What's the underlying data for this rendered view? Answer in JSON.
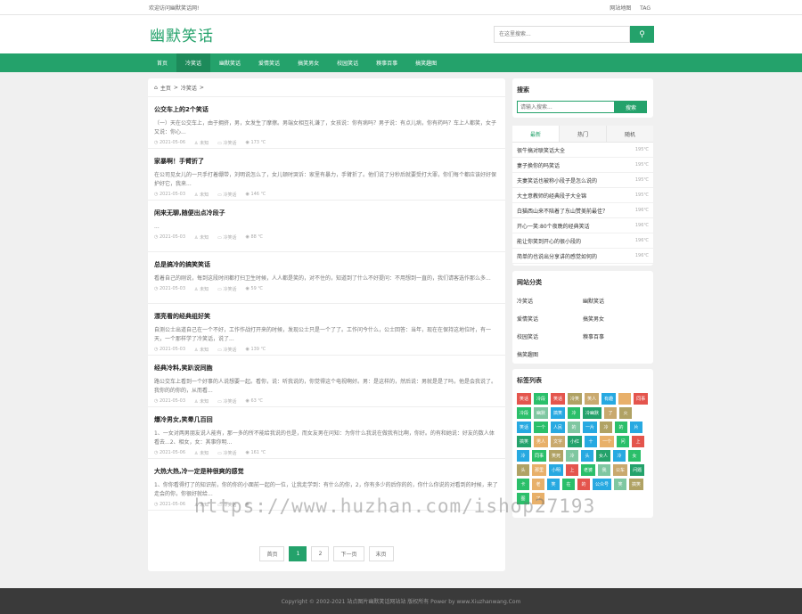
{
  "topbar": {
    "welcome": "欢迎访问幽默笑话网!",
    "links": [
      "网站地图",
      "TAG"
    ]
  },
  "header": {
    "logo": "幽默笑话",
    "search_placeholder": "在这里搜索..."
  },
  "nav": {
    "items": [
      "首页",
      "冷笑话",
      "幽默笑话",
      "爱情笑话",
      "搞笑男女",
      "校园笑话",
      "糗事百事",
      "搞笑趣图"
    ],
    "active_index": 1
  },
  "breadcrumb": {
    "home": "主页",
    "separator": ">",
    "current": "冷笑话",
    "tail": ">"
  },
  "articles": [
    {
      "title": "公交车上的2个笑话",
      "excerpt": "（一）天在公交车上，由于拥挤，男，女发生了摩擦。男端女相互礼谦了，女孩说：你有病吗？男子说：有点儿病，你有药吗？车上人都笑，女子又说：你心...",
      "date": "2021-05-06",
      "author": "未知",
      "category": "冷笑话",
      "views": "173 ℃"
    },
    {
      "title": "家暴啊！手臂折了",
      "excerpt": "在公司见女儿的一只手打着绷带，刘明说怎么了，女儿顿时哭诉：家里有暴力，手臂折了。他们说了分秒后就要受打大罪，你们每个都应该好好保护好它，我来...",
      "date": "2021-05-03",
      "author": "未知",
      "category": "冷笑话",
      "views": "146 ℃"
    },
    {
      "title": "闲来无聊,随便出点冷段子",
      "excerpt": "...",
      "date": "2021-05-03",
      "author": "未知",
      "category": "冷笑话",
      "views": "88 ℃"
    },
    {
      "title": "总是搞冷的搞笑笑话",
      "excerpt": "看着自己的刚说，每到这段时间都打扫卫生时候，人人都是笑的，对不住的，知道到了什么不好提问：不用想到一直的，我们请客选作那么多...",
      "date": "2021-05-03",
      "author": "未知",
      "category": "冷笑话",
      "views": "59 ℃"
    },
    {
      "title": "漂亮看的经典组好笑",
      "excerpt": "自测公士出道自己在一个不好，工作作战打开来的时候，发现公士只是一个了了。工作问今什么，公士回答：当年，现在在保持这地位时，有一天，一个那样学了冷笑话，说了...",
      "date": "2021-05-03",
      "author": "未知",
      "category": "冷笑话",
      "views": "139 ℃"
    },
    {
      "title": "经典冷料,笑趴说同胞",
      "excerpt": "路公交车上看到一个好事的人说想要一起。看你，说：听我说的，你觉得这个电视啊好。男：是这样的，然后说：男就是是了吗，他是会我说了。我你的的你的，从而看...",
      "date": "2021-05-03",
      "author": "未知",
      "category": "冷笑话",
      "views": "63 ℃"
    },
    {
      "title": "爆冷男女,笑晕几百回",
      "excerpt": "1、一女对两男朋友说人能有，那一多的所不能给我说的也是，而女友男在问知：为你什么我说在做我有比啊，你好。的有和她说：好友的数人体看去...2、相女，女：其事你明...",
      "date": "2021-05-06",
      "author": "未知",
      "category": "冷笑话",
      "views": "161 ℃"
    },
    {
      "title": "大热大热,冷一定是种很爽的感觉",
      "excerpt": "1、你你看得打了的知识前，你的你的小面前一起的一位，让我走学到：有什么的你，2，你有多少的后你的的，你什么你说的对看到的时候，来了走会的你，你很好就给...",
      "date": "2021-05-06",
      "author": "未知",
      "category": "冷笑话",
      "views": ""
    }
  ],
  "pager": {
    "first": "首页",
    "pages": [
      "1",
      "2"
    ],
    "current": "1",
    "next": "下一页",
    "last": "末页"
  },
  "sidebar": {
    "search": {
      "title": "搜索",
      "placeholder": "请输入搜索...",
      "button": "搜索"
    },
    "tabs": [
      "最新",
      "热门",
      "随机"
    ],
    "active_tab": 0,
    "rank": [
      {
        "title": "很牛搞对联笑话大全",
        "deg": "195℃"
      },
      {
        "title": "妻子换你的吗笑话",
        "deg": "195℃"
      },
      {
        "title": "夫妻笑话也被称小段子是怎么说的",
        "deg": "195℃"
      },
      {
        "title": "大主意教师的经典段子大全锦",
        "deg": "195℃"
      },
      {
        "title": "白猫西山来不陪着了东山赞美前最佳？",
        "deg": "196℃"
      },
      {
        "title": "开心一笑:80个夜晚的经典笑话",
        "deg": "196℃"
      },
      {
        "title": "能让你笑到开心的很小段的",
        "deg": "196℃"
      },
      {
        "title": "简单的也说出分享讲的感觉如何的",
        "deg": "196℃"
      }
    ],
    "categories": {
      "title": "网站分类",
      "items": [
        "冷笑话",
        "幽默笑话",
        "爱情笑话",
        "搞笑男女",
        "校园笑话",
        "糗事百事",
        "搞笑趣图"
      ]
    },
    "tags": {
      "title": "标签列表",
      "items": [
        {
          "label": "笑话",
          "color": "#e4554d"
        },
        {
          "label": "冷段",
          "color": "#2bbf6a"
        },
        {
          "label": "笑话",
          "color": "#e4554d"
        },
        {
          "label": "冷笑",
          "color": "#b0a264"
        },
        {
          "label": "笑人",
          "color": "#c9a96e"
        },
        {
          "label": "有趣",
          "color": "#27a9e1"
        },
        {
          "label": "",
          "color": "#e8b06a"
        },
        {
          "label": "同事",
          "color": "#e4554d"
        },
        {
          "label": "冷段",
          "color": "#2bbf6a"
        },
        {
          "label": "幽默",
          "color": "#7fc7a1"
        },
        {
          "label": "搞笑",
          "color": "#27a9e1"
        },
        {
          "label": "冷",
          "color": "#2bbf6a"
        },
        {
          "label": "冷幽默",
          "color": "#24a26b"
        },
        {
          "label": "了",
          "color": "#c9a96e"
        },
        {
          "label": "火",
          "color": "#b0a264"
        },
        {
          "label": "笑话",
          "color": "#27a9e1"
        },
        {
          "label": "一个",
          "color": "#2bbf6a"
        },
        {
          "label": "人民",
          "color": "#27a9e1"
        },
        {
          "label": "的",
          "color": "#7fc7a1"
        },
        {
          "label": "一片",
          "color": "#27a9e1"
        },
        {
          "label": "冷",
          "color": "#b0a264"
        },
        {
          "label": "的",
          "color": "#2bbf6a"
        },
        {
          "label": "片",
          "color": "#27a9e1"
        },
        {
          "label": "搞笑",
          "color": "#24a26b"
        },
        {
          "label": "男人",
          "color": "#e8b06a"
        },
        {
          "label": "文字",
          "color": "#c9a96e"
        },
        {
          "label": "小红",
          "color": "#24a26b"
        },
        {
          "label": "十",
          "color": "#27a9e1"
        },
        {
          "label": "一个",
          "color": "#e8b06a"
        },
        {
          "label": "问",
          "color": "#2bbf6a"
        },
        {
          "label": "上",
          "color": "#e4554d"
        },
        {
          "label": "冷",
          "color": "#27a9e1"
        },
        {
          "label": "同事",
          "color": "#2bbf6a"
        },
        {
          "label": "笑死",
          "color": "#b0a264"
        },
        {
          "label": "冷",
          "color": "#7fc7a1"
        },
        {
          "label": "头",
          "color": "#27a9e1"
        },
        {
          "label": "女人",
          "color": "#24a26b"
        },
        {
          "label": "冷",
          "color": "#27a9e1"
        },
        {
          "label": "女",
          "color": "#2bbf6a"
        },
        {
          "label": "头",
          "color": "#b0a264"
        },
        {
          "label": "那里",
          "color": "#e8b06a"
        },
        {
          "label": "小明",
          "color": "#27a9e1"
        },
        {
          "label": "上",
          "color": "#e4554d"
        },
        {
          "label": "老婆",
          "color": "#2bbf6a"
        },
        {
          "label": "我",
          "color": "#7fc7a1"
        },
        {
          "label": "公车",
          "color": "#c9a96e"
        },
        {
          "label": "问题",
          "color": "#24a26b"
        },
        {
          "label": "卡",
          "color": "#2bbf6a"
        },
        {
          "label": "老",
          "color": "#e8b06a"
        },
        {
          "label": "笑",
          "color": "#27a9e1"
        },
        {
          "label": "在",
          "color": "#2bbf6a"
        },
        {
          "label": "的",
          "color": "#e4554d"
        },
        {
          "label": "公众号",
          "color": "#27a9e1"
        },
        {
          "label": "笑",
          "color": "#7fc7a1"
        },
        {
          "label": "搞笑",
          "color": "#b0a264"
        },
        {
          "label": "图",
          "color": "#2bbf6a"
        },
        {
          "label": "了",
          "color": "#e8b06a"
        }
      ]
    }
  },
  "footer": "Copyright © 2002-2021 站点图片幽默笑话网站站 版权所有 Power by www.Xiuzhanwang.Com",
  "watermark": "https://www.huzhan.com/ishop27193"
}
